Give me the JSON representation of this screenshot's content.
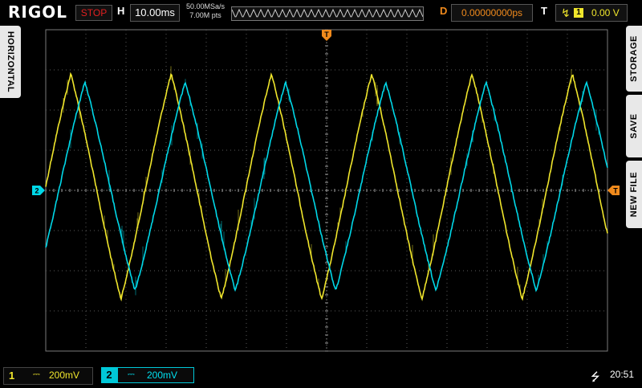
{
  "header": {
    "logo": "RIGOL",
    "run_status": "STOP",
    "horizontal_label": "H",
    "timebase": "10.00ms",
    "sample_rate": "50.00MSa/s",
    "memory_depth": "7.00M pts",
    "delay_label": "D",
    "delay": "0.00000000ps",
    "trigger_label": "T",
    "trigger_source": "1",
    "trigger_level": "0.00 V"
  },
  "side_left": {
    "label": "HORIZONTAL"
  },
  "side_right": {
    "storage": "STORAGE",
    "save": "SAVE",
    "new_file": "NEW FILE"
  },
  "markers": {
    "trigger_pos": "T",
    "trigger_level": "T",
    "ch2_offset": "2"
  },
  "footer": {
    "ch1": {
      "number": "1",
      "coupling": "⎓",
      "scale": "200mV"
    },
    "ch2": {
      "number": "2",
      "coupling": "⎓",
      "scale": "200mV"
    },
    "usb_icon": "usb-icon",
    "time": "20:51"
  },
  "colors": {
    "ch1": "#f0e62c",
    "ch2": "#00d8e8",
    "trigger": "#f08a1c",
    "stop": "#e02020",
    "grid": "#5a5a5a"
  },
  "chart_data": {
    "type": "line",
    "title": "",
    "xlabel": "",
    "ylabel": "",
    "x_divisions": 14,
    "y_divisions": 8,
    "grid": true,
    "x_per_div_ms": 10,
    "y_per_div_mV": 200,
    "series": [
      {
        "channel": "1",
        "peaks_div": 2.9,
        "troughs_div": -2.7,
        "period_div": 2.5,
        "phase_div": 0.0
      },
      {
        "channel": "2",
        "peaks_div": 2.7,
        "troughs_div": -2.5,
        "period_div": 2.5,
        "phase_div": 0.35
      }
    ]
  }
}
